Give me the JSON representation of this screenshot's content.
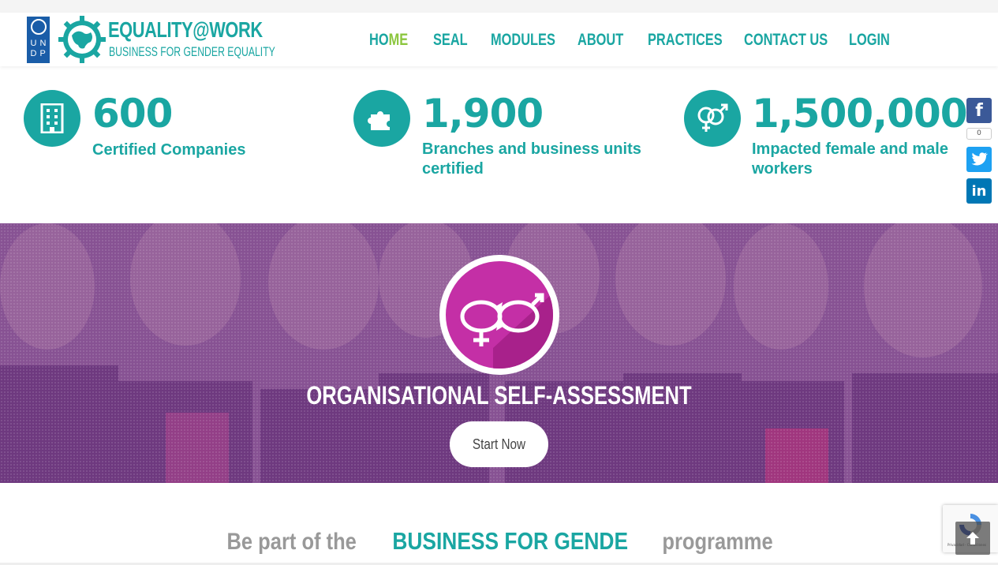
{
  "header": {
    "undp_letters": [
      "U",
      "N",
      "D",
      "P"
    ],
    "brand_title": "EQUALITY@WORK",
    "brand_subtitle": "BUSINESS FOR GENDER EQUALITY",
    "nav": [
      {
        "label": "HOME",
        "active": true
      },
      {
        "label": "SEAL"
      },
      {
        "label": "MODULES"
      },
      {
        "label": "ABOUT"
      },
      {
        "label": "PRACTICES"
      },
      {
        "label": "CONTACT US"
      },
      {
        "label": "LOGIN"
      }
    ],
    "accent_color": "#1aa6a2",
    "active_color": "#8cc63e"
  },
  "stats": [
    {
      "icon": "building-icon",
      "number": "600",
      "label": "Certified Companies"
    },
    {
      "icon": "puzzle-icon",
      "number": "1,900",
      "label": "Branches and business units certified"
    },
    {
      "icon": "gender-symbols-icon",
      "number": "1,500,000",
      "label": "Impacted female and male workers"
    }
  ],
  "banner": {
    "title": "ORGANISATIONAL SELF-ASSESSMENT",
    "button_label": "Start Now",
    "overlay_color": "#82329b",
    "logo_color": "#c42fa6"
  },
  "social": {
    "share_count": "0",
    "networks": [
      {
        "icon": "facebook-icon",
        "color": "#3b5998"
      },
      {
        "icon": "twitter-icon",
        "color": "#1da1f2"
      },
      {
        "icon": "linkedin-icon",
        "color": "#0077b5"
      }
    ]
  },
  "recaptcha": {
    "text": "Privacidad - Condiciones"
  },
  "cta": {
    "pre": "Be part of the",
    "emphasis": "BUSINESS FOR GENDE",
    "post": "programme"
  }
}
